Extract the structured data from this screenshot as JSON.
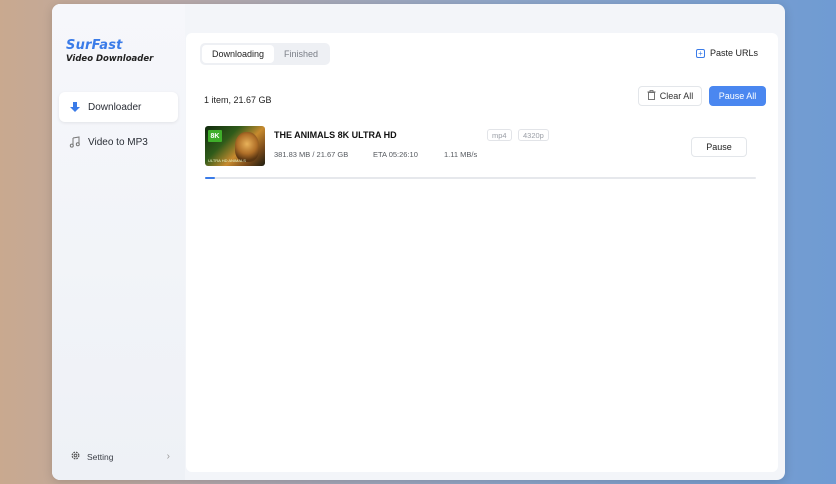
{
  "app": {
    "name": "SurFast",
    "subtitle": "Video Downloader"
  },
  "sidebar": {
    "items": [
      {
        "label": "Downloader",
        "icon": "download-arrow-icon",
        "active": true
      },
      {
        "label": "Video to MP3",
        "icon": "music-note-icon",
        "active": false
      }
    ],
    "setting_label": "Setting"
  },
  "tabs": [
    {
      "label": "Downloading",
      "active": true
    },
    {
      "label": "Finished",
      "active": false
    }
  ],
  "toolbar": {
    "paste_label": "Paste URLs",
    "summary": "1 item, 21.67 GB",
    "clear_label": "Clear All",
    "pause_all_label": "Pause All"
  },
  "download": {
    "title": "THE ANIMALS 8K ULTRA HD",
    "format": "mp4",
    "resolution": "4320p",
    "size": "381.83 MB / 21.67 GB",
    "eta": "ETA 05:26:10",
    "speed": "1.11 MB/s",
    "pause_label": "Pause",
    "progress": 0.0176,
    "thumbnail_badge": "8K",
    "thumbnail_caption": "ULTRA HD ANIMALS"
  },
  "colors": {
    "accent": "#3a7be8",
    "primary_button": "#4a87f0"
  }
}
